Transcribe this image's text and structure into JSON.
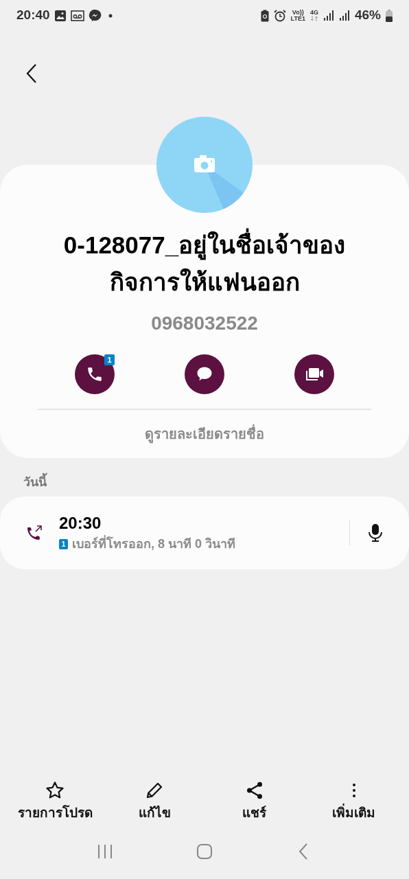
{
  "status_bar": {
    "time": "20:40",
    "volte_top": "Vo))",
    "volte_bottom": "LTE1",
    "network": "4G",
    "battery": "46%"
  },
  "contact": {
    "name": "0-128077_อยู่ในชื่อเจ้าของกิจการให้แฟนออก",
    "number": "0968032522",
    "call_badge": "1",
    "details_link": "ดูรายละเอียดรายชื่อ"
  },
  "section_title": "วันนี้",
  "call_log": [
    {
      "time": "20:30",
      "sim": "1",
      "description": "เบอร์ที่โทรออก, 8 นาที 0 วินาที"
    }
  ],
  "bottom_actions": [
    {
      "kind": "star",
      "label": "รายการโปรด"
    },
    {
      "kind": "edit",
      "label": "แก้ไข"
    },
    {
      "kind": "share",
      "label": "แชร์"
    },
    {
      "kind": "more",
      "label": "เพิ่มเติม"
    }
  ]
}
